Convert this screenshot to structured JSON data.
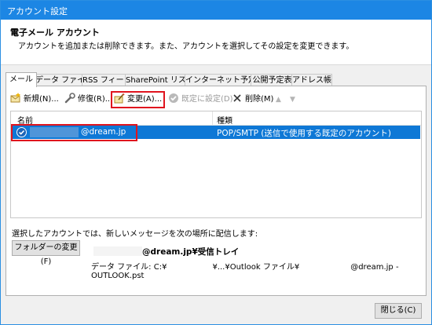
{
  "window": {
    "title": "アカウント設定"
  },
  "header": {
    "title": "電子メール アカウント",
    "subtitle": "アカウントを追加または削除できます。また、アカウントを選択してその設定を変更できます。"
  },
  "tabs": [
    {
      "label": "メール",
      "active": true
    },
    {
      "label": "データ ファイル"
    },
    {
      "label": "RSS フィード"
    },
    {
      "label": "SharePoint リスト"
    },
    {
      "label": "インターネット予定表"
    },
    {
      "label": "公開予定表"
    },
    {
      "label": "アドレス帳"
    }
  ],
  "toolbar": {
    "new_label": "新規(N)...",
    "repair_label": "修復(R)...",
    "change_label": "変更(A)...",
    "default_label": "既定に設定(D)",
    "remove_label": "削除(M)",
    "up_arrow": "▲",
    "down_arrow": "▼"
  },
  "list": {
    "col_name": "名前",
    "col_type": "種類",
    "rows": [
      {
        "name": "@dream.jp",
        "type": "POP/SMTP (送信で使用する既定のアカウント)",
        "selected": true
      }
    ]
  },
  "delivery": {
    "label": "選択したアカウントでは、新しいメッセージを次の場所に配信します:",
    "change_folder_label": "フォルダーの変更(F)",
    "inbox_label": "@dream.jp¥受信トレイ",
    "data_file_prefix": "データ ファイル: C:¥",
    "data_file_mid": "¥...¥Outlook ファイル¥",
    "data_file_suffix": "@dream.jp - OUTLOOK.pst"
  },
  "footer": {
    "close_label": "閉じる(C)"
  },
  "colors": {
    "titlebar": "#1c86e4",
    "selection": "#0e78d6",
    "highlight": "#e0141e"
  }
}
